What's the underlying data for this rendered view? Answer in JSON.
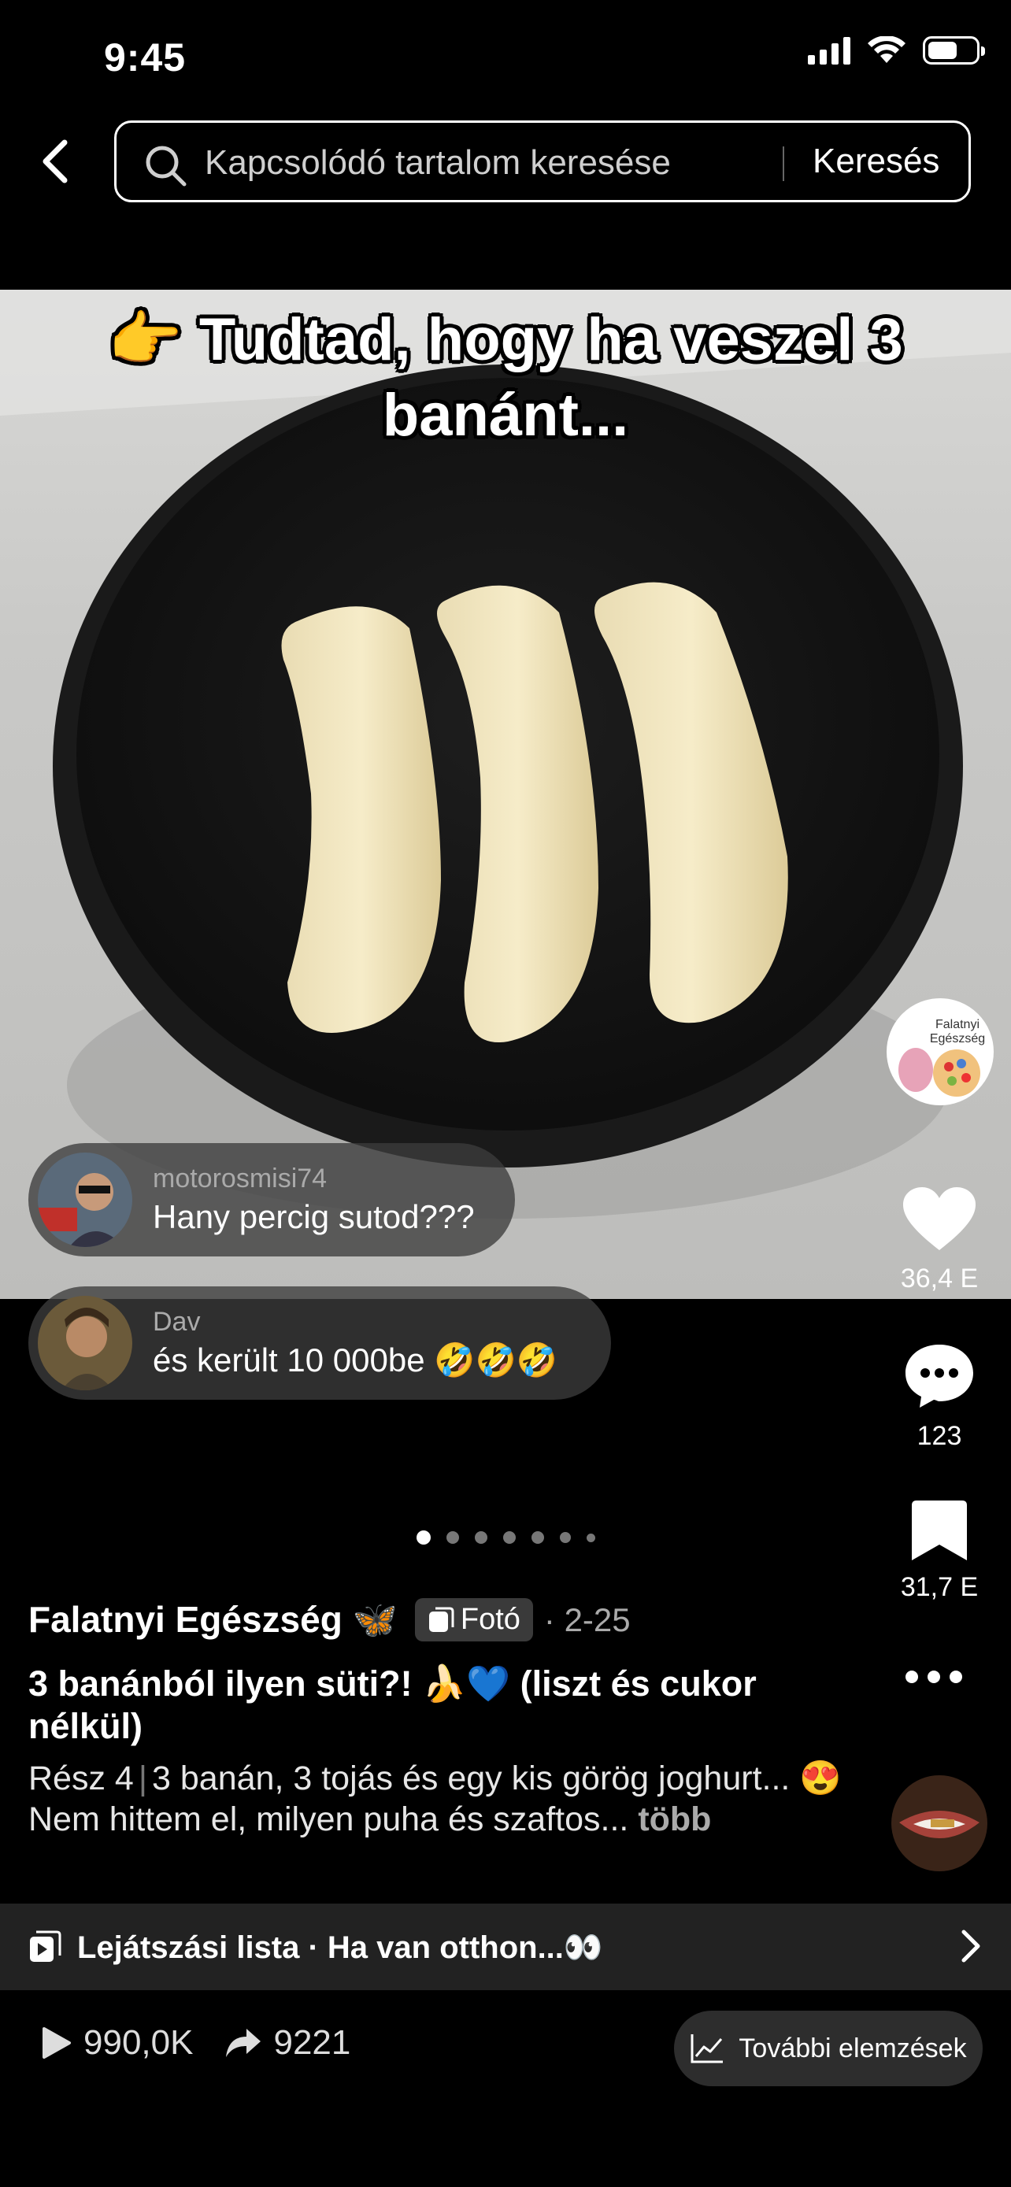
{
  "status_bar": {
    "time": "9:45"
  },
  "header": {
    "search_placeholder": "Kapcsolódó tartalom keresése",
    "search_button": "Keresés"
  },
  "media": {
    "overlay_text": "👉 Tudtad, hogy ha veszel 3 banánt..."
  },
  "comments": [
    {
      "username": "motorosmisi74",
      "text": "Hany percig sutod???"
    },
    {
      "username": "Dav",
      "text": "és került 10 000be 🤣🤣🤣"
    }
  ],
  "actions": {
    "likes": "36,4 E",
    "comments": "123",
    "saves": "31,7 E"
  },
  "creator_avatar_text": "Falatnyi Egészség",
  "carousel": {
    "total": 7,
    "active": 0
  },
  "post": {
    "author": "Falatnyi Egészség 🦋",
    "type_badge": "Fotó",
    "date": "· 2-25",
    "title": "3 banánból ilyen süti?! 🍌💙 (liszt és cukor nélkül)",
    "part": "Rész 4",
    "description_line1": "3 banán, 3 tojás és egy kis görög joghurt... 😍",
    "description_line2": "Nem hittem el, milyen puha és szaftos...",
    "more": "több"
  },
  "playlist": {
    "label": "Lejátszási lista · Ha van otthon...👀"
  },
  "stats": {
    "views": "990,0K",
    "shares": "9221",
    "analytics_button": "További elemzések"
  }
}
